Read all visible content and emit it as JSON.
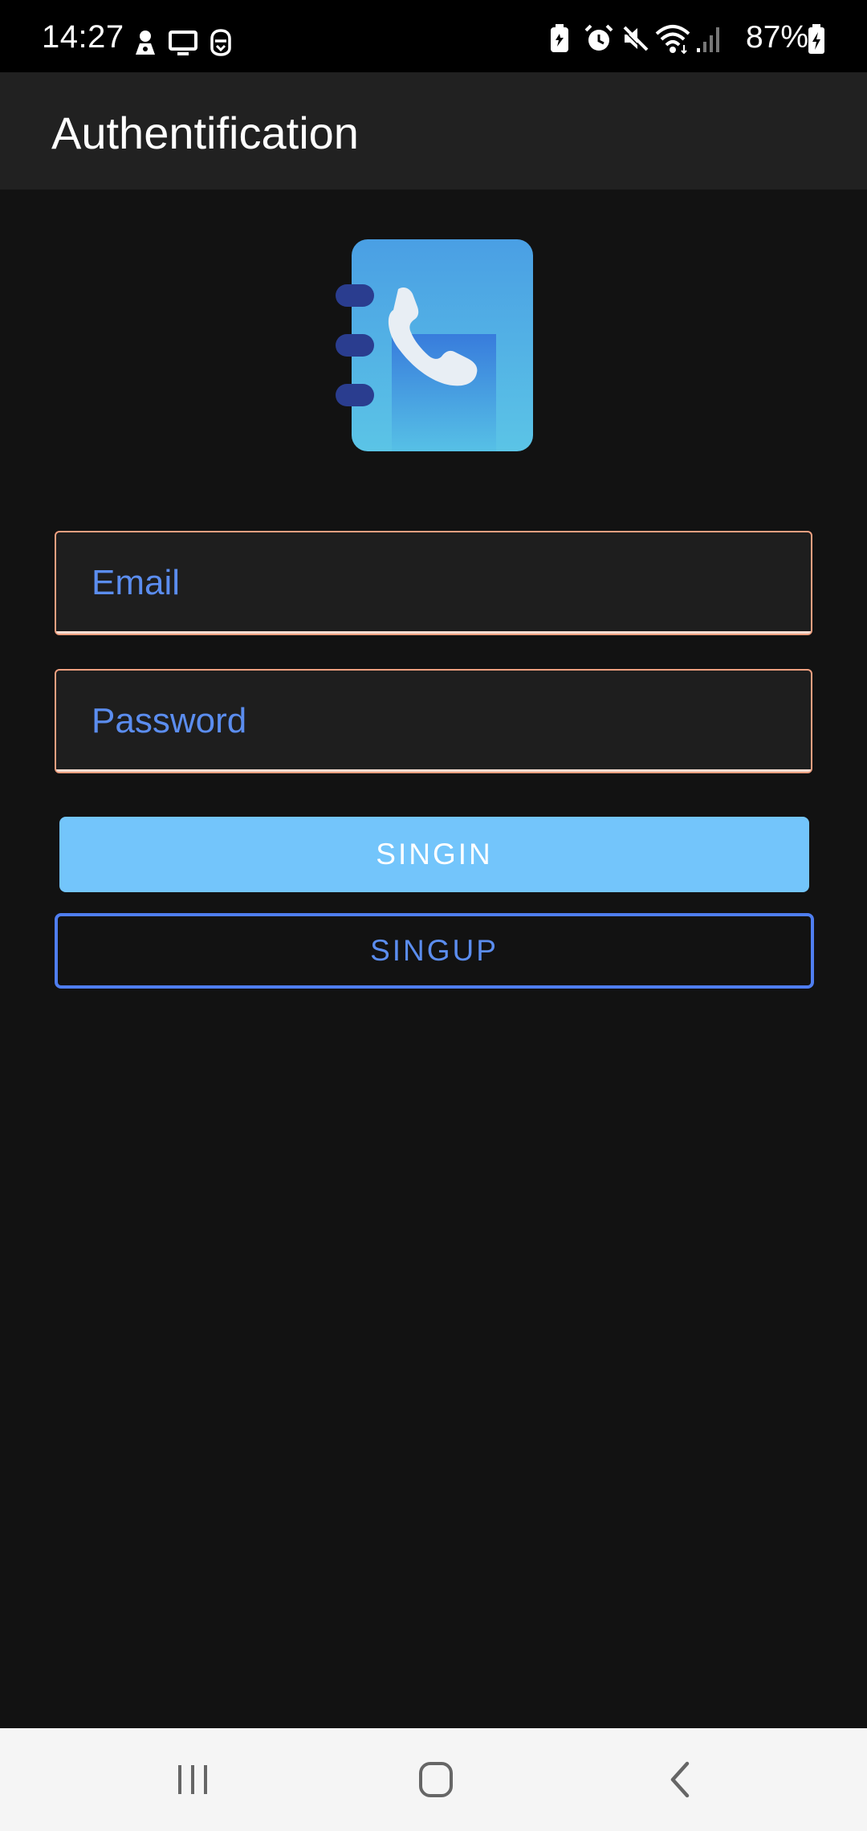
{
  "status_bar": {
    "time": "14:27",
    "battery_percent": "87%",
    "left_icons": [
      "notification-person-icon",
      "cast-screen-icon",
      "vpn-shield-icon"
    ],
    "right_icons": [
      "battery-saver-icon",
      "alarm-icon",
      "mute-icon",
      "wifi-icon",
      "cell-signal-icon",
      "battery-charging-icon"
    ]
  },
  "app_bar": {
    "title": "Authentification"
  },
  "logo": {
    "icon": "contact-book-phone-icon",
    "colors": {
      "cover": "#4fa8e8",
      "rings": "#2a3d8f",
      "handset": "#e8eef4"
    }
  },
  "form": {
    "email": {
      "placeholder": "Email",
      "value": ""
    },
    "password": {
      "placeholder": "Password",
      "value": ""
    },
    "signin_label": "SINGIN",
    "signup_label": "SINGUP"
  },
  "nav_bar": {
    "items": [
      "recent-apps-icon",
      "home-icon",
      "back-icon"
    ]
  },
  "colors": {
    "background": "#121212",
    "app_bar": "#212121",
    "primary_button": "#73c5fb",
    "accent_blue": "#5b8def",
    "field_border": "#f0a080"
  }
}
